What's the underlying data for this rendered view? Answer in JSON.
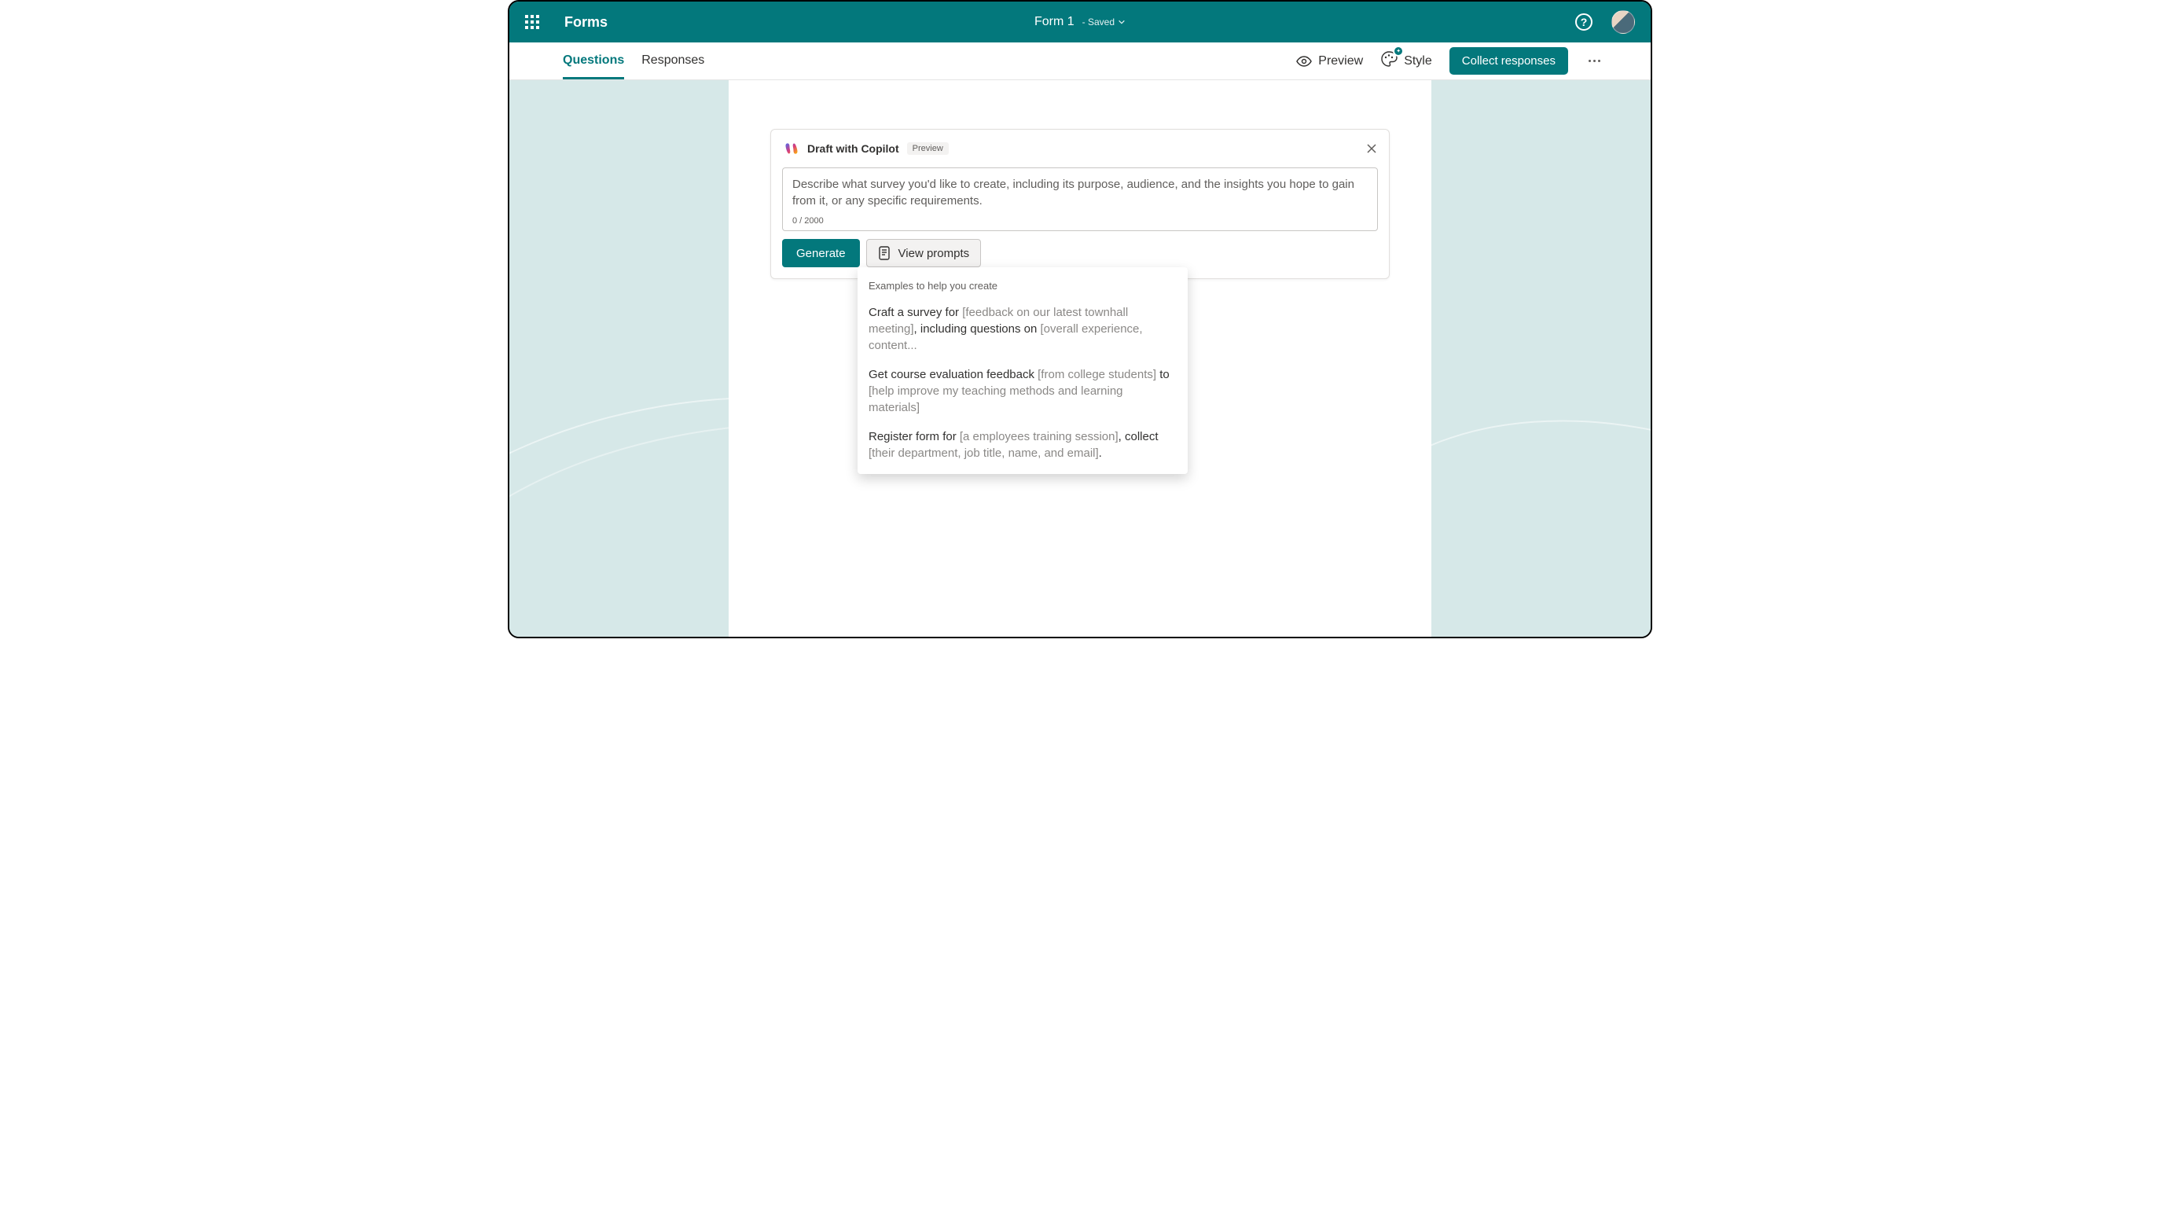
{
  "app": {
    "name": "Forms"
  },
  "doc": {
    "title": "Form 1",
    "status": "- Saved"
  },
  "tabs": {
    "questions": "Questions",
    "responses": "Responses"
  },
  "actions": {
    "preview": "Preview",
    "style": "Style",
    "collect": "Collect responses"
  },
  "copilot": {
    "title": "Draft with Copilot",
    "badge": "Preview",
    "placeholder": "Describe what survey you'd like to create, including its purpose, audience, and the insights you hope to gain from it, or any specific requirements.",
    "count": "0 / 2000",
    "generate": "Generate",
    "view_prompts": "View prompts"
  },
  "prompts": {
    "header": "Examples to help you create",
    "items": [
      {
        "parts": [
          {
            "t": "Craft a survey for ",
            "s": true
          },
          {
            "t": "[feedback on our latest townhall meeting]",
            "s": false
          },
          {
            "t": ", including questions on ",
            "s": true
          },
          {
            "t": "[overall experience, content...",
            "s": false
          }
        ]
      },
      {
        "parts": [
          {
            "t": "Get course evaluation feedback ",
            "s": true
          },
          {
            "t": "[from college students]",
            "s": false
          },
          {
            "t": " to ",
            "s": true
          },
          {
            "t": "[help improve my teaching methods and learning materials]",
            "s": false
          }
        ]
      },
      {
        "parts": [
          {
            "t": "Register form for ",
            "s": true
          },
          {
            "t": "[a employees training session]",
            "s": false
          },
          {
            "t": ", collect ",
            "s": true
          },
          {
            "t": "[their department, job title, name, and email]",
            "s": false
          },
          {
            "t": ".",
            "s": true
          }
        ]
      }
    ]
  }
}
